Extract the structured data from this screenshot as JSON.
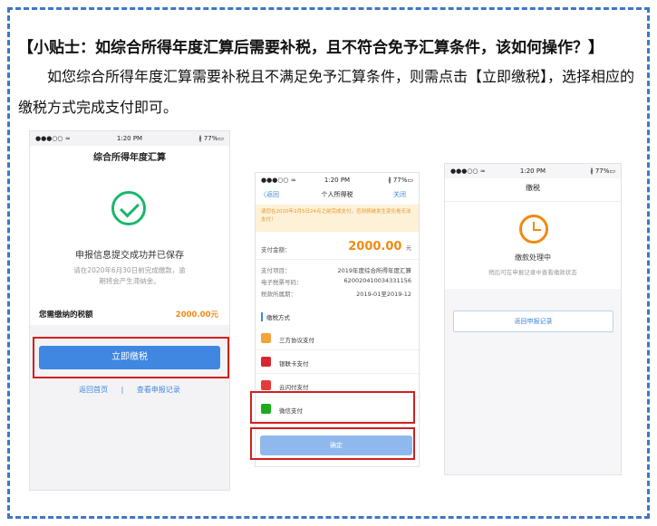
{
  "tip": {
    "title": "【小贴士：如综合所得年度汇算后需要补税，且不符合免予汇算条件，该如何操作？】",
    "body": "如您综合所得年度汇算需要补税且不满足免予汇算条件，则需点击【立即缴税】，选择相应的缴税方式完成支付即可。"
  },
  "phone1": {
    "status_left": "●●●○○ ≈",
    "status_time": "1:20 PM",
    "status_right": "∦ 77%▭",
    "title": "综合所得年度汇算",
    "success": "申报信息提交成功并已保存",
    "note": "请在2020年6月30日前完成缴款，逾期将会产生滞纳金。",
    "tax_label": "您需缴纳的税额",
    "tax_amount": "2000.00元",
    "pay_button": "立即缴税",
    "link_home": "返回首页",
    "link_sep": "|",
    "link_records": "查看申报记录"
  },
  "phone2": {
    "status_left": "●●●○○ ≈",
    "status_time": "1:20 PM",
    "status_right": "∦ 77%▭",
    "back": "〈返回",
    "title": "个人所得税",
    "close": "关闭",
    "notice": "请您在2020年2月5日24点之前完成支付，否则将被发生变化卷无法支付！",
    "amount_label": "支付金额：",
    "amount_value": "2000.00",
    "amount_unit": "元",
    "info": [
      {
        "k": "支付项目：",
        "v": "2019年度综合所得年度汇算"
      },
      {
        "k": "电子税票号码：",
        "v": "620020410034331156"
      },
      {
        "k": "税款所属期：",
        "v": "2019-01至2019-12"
      }
    ],
    "method_title": "缴税方式",
    "methods": [
      "三方协议支付",
      "银联卡支付",
      "云闪付支付",
      "微信支付"
    ],
    "method_colors": [
      "#f2a33a",
      "#d8262e",
      "#e53b3b",
      "#1aad19"
    ],
    "confirm": "确定"
  },
  "phone3": {
    "status_left": "●●●○○ ≈",
    "status_time": "1:20 PM",
    "status_right": "∦ 77%▭",
    "title": "缴税",
    "state": "缴款处理中",
    "hint": "稍后可在申报记录中查看缴款状态",
    "back_records": "返回申报记录"
  }
}
